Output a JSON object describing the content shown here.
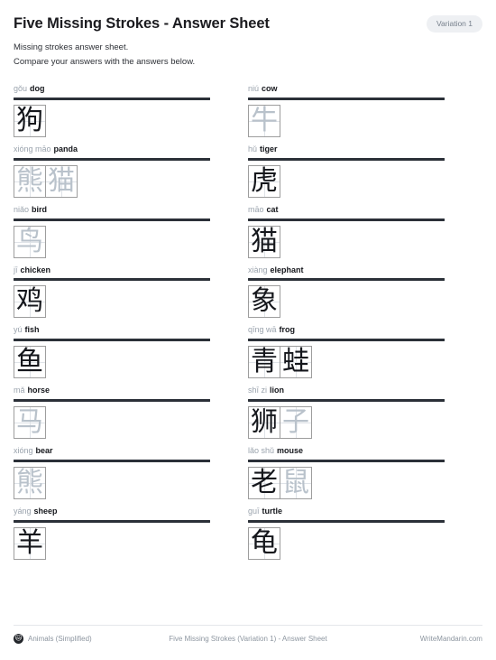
{
  "header": {
    "title": "Five Missing Strokes - Answer Sheet",
    "badge": "Variation 1",
    "subtitle_line1": "Missing strokes answer sheet.",
    "subtitle_line2": "Compare your answers with the answers below."
  },
  "entries": [
    {
      "pinyin": "gǒu",
      "english": "dog",
      "chars": [
        {
          "char": "狗",
          "shade": "dark"
        }
      ]
    },
    {
      "pinyin": "niú",
      "english": "cow",
      "chars": [
        {
          "char": "牛",
          "shade": "faint"
        }
      ]
    },
    {
      "pinyin": "xióng māo",
      "english": "panda",
      "chars": [
        {
          "char": "熊",
          "shade": "faint"
        },
        {
          "char": "猫",
          "shade": "faint"
        }
      ]
    },
    {
      "pinyin": "hǔ",
      "english": "tiger",
      "chars": [
        {
          "char": "虎",
          "shade": "dark"
        }
      ]
    },
    {
      "pinyin": "niǎo",
      "english": "bird",
      "chars": [
        {
          "char": "鸟",
          "shade": "faint"
        }
      ]
    },
    {
      "pinyin": "māo",
      "english": "cat",
      "chars": [
        {
          "char": "猫",
          "shade": "dark"
        }
      ]
    },
    {
      "pinyin": "jī",
      "english": "chicken",
      "chars": [
        {
          "char": "鸡",
          "shade": "dark"
        }
      ]
    },
    {
      "pinyin": "xiàng",
      "english": "elephant",
      "chars": [
        {
          "char": "象",
          "shade": "dark"
        }
      ]
    },
    {
      "pinyin": "yú",
      "english": "fish",
      "chars": [
        {
          "char": "鱼",
          "shade": "dark"
        }
      ]
    },
    {
      "pinyin": "qīng wā",
      "english": "frog",
      "chars": [
        {
          "char": "青",
          "shade": "dark"
        },
        {
          "char": "蛙",
          "shade": "dark"
        }
      ]
    },
    {
      "pinyin": "mǎ",
      "english": "horse",
      "chars": [
        {
          "char": "马",
          "shade": "faint"
        }
      ]
    },
    {
      "pinyin": "shī zi",
      "english": "lion",
      "chars": [
        {
          "char": "狮",
          "shade": "dark"
        },
        {
          "char": "子",
          "shade": "faint"
        }
      ]
    },
    {
      "pinyin": "xióng",
      "english": "bear",
      "chars": [
        {
          "char": "熊",
          "shade": "faint"
        }
      ]
    },
    {
      "pinyin": "lǎo shǔ",
      "english": "mouse",
      "chars": [
        {
          "char": "老",
          "shade": "dark"
        },
        {
          "char": "鼠",
          "shade": "faint"
        }
      ]
    },
    {
      "pinyin": "yáng",
      "english": "sheep",
      "chars": [
        {
          "char": "羊",
          "shade": "dark"
        }
      ]
    },
    {
      "pinyin": "guī",
      "english": "turtle",
      "chars": [
        {
          "char": "龟",
          "shade": "dark"
        }
      ]
    }
  ],
  "footer": {
    "icon": "animal-face-icon",
    "icon_glyph": "🐱",
    "category": "Animals (Simplified)",
    "center": "Five Missing Strokes (Variation 1) - Answer Sheet",
    "site": "WriteMandarin.com"
  },
  "colors": {
    "rule": "#2b3038",
    "pinyin": "#9aa3ad",
    "english": "#15171c",
    "faint_glyph": "#b9c2cb",
    "badge_bg": "#eef0f3"
  }
}
